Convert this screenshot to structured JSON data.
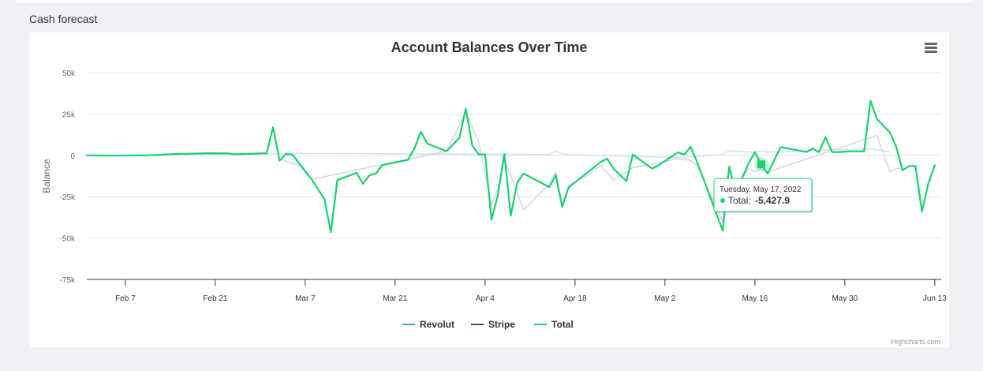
{
  "page": {
    "section_title": "Cash forecast"
  },
  "chart_menu": {
    "icon": "hamburger-menu-icon"
  },
  "credits": "Highcharts.com",
  "tooltip": {
    "date": "Tuesday, May 17, 2022",
    "series_label": "Total:",
    "value": "-5,427.9"
  },
  "colors": {
    "revolut": "#4a9fe0",
    "stripe": "#434891",
    "total": "#1bd06e",
    "grid": "#e6e6e6"
  },
  "chart_data": {
    "type": "line",
    "title": "Account Balances Over Time",
    "xlabel": "",
    "ylabel": "Balance",
    "ylim": [
      -75000,
      50000
    ],
    "yticks": [
      50000,
      25000,
      0,
      -25000,
      -50000,
      -75000
    ],
    "ytick_labels": [
      "50k",
      "25k",
      "0",
      "-25k",
      "-50k",
      "-75k"
    ],
    "xticks": [
      "2022-02-07",
      "2022-02-21",
      "2022-03-07",
      "2022-03-21",
      "2022-04-04",
      "2022-04-18",
      "2022-05-02",
      "2022-05-16",
      "2022-05-30",
      "2022-06-13"
    ],
    "xtick_labels": [
      "Feb 7",
      "Feb 21",
      "Mar 7",
      "Mar 21",
      "Apr 4",
      "Apr 18",
      "May 2",
      "May 16",
      "May 30",
      "Jun 13"
    ],
    "xlim": [
      "2022-02-01",
      "2022-06-14"
    ],
    "legend": [
      "Revolut",
      "Stripe",
      "Total"
    ],
    "legend_position": "bottom-center",
    "grid": true,
    "series": [
      {
        "name": "Total",
        "x": [
          "2022-02-01",
          "2022-02-05",
          "2022-02-10",
          "2022-02-15",
          "2022-02-20",
          "2022-02-23",
          "2022-02-24",
          "2022-03-01",
          "2022-03-02",
          "2022-03-03",
          "2022-03-04",
          "2022-03-05",
          "2022-03-08",
          "2022-03-10",
          "2022-03-11",
          "2022-03-12",
          "2022-03-15",
          "2022-03-16",
          "2022-03-17",
          "2022-03-18",
          "2022-03-19",
          "2022-03-23",
          "2022-03-24",
          "2022-03-25",
          "2022-03-26",
          "2022-03-29",
          "2022-03-31",
          "2022-04-01",
          "2022-04-02",
          "2022-04-03",
          "2022-04-04",
          "2022-04-05",
          "2022-04-06",
          "2022-04-07",
          "2022-04-08",
          "2022-04-09",
          "2022-04-10",
          "2022-04-14",
          "2022-04-15",
          "2022-04-16",
          "2022-04-17",
          "2022-04-22",
          "2022-04-23",
          "2022-04-24",
          "2022-04-26",
          "2022-04-27",
          "2022-04-30",
          "2022-05-01",
          "2022-05-04",
          "2022-05-05",
          "2022-05-06",
          "2022-05-07",
          "2022-05-11",
          "2022-05-12",
          "2022-05-13",
          "2022-05-15",
          "2022-05-16",
          "2022-05-17",
          "2022-05-18",
          "2022-05-20",
          "2022-05-24",
          "2022-05-25",
          "2022-05-26",
          "2022-05-27",
          "2022-05-28",
          "2022-05-29",
          "2022-05-31",
          "2022-06-02",
          "2022-06-03",
          "2022-06-04",
          "2022-06-06",
          "2022-06-07",
          "2022-06-08",
          "2022-06-09",
          "2022-06-10",
          "2022-06-11",
          "2022-06-12",
          "2022-06-13"
        ],
        "values": [
          0,
          -200,
          0,
          800,
          1300,
          1200,
          600,
          1300,
          17000,
          -3200,
          800,
          500,
          -14500,
          -26500,
          -46500,
          -15000,
          -10500,
          -17200,
          -12000,
          -11000,
          -5900,
          -2700,
          4200,
          14300,
          7100,
          2500,
          10600,
          28200,
          6000,
          500,
          600,
          -39000,
          -24000,
          800,
          -36500,
          -16500,
          -11000,
          -19200,
          -12000,
          -31000,
          -19500,
          -4000,
          -2000,
          -8000,
          -15600,
          500,
          -8000,
          -6000,
          1800,
          400,
          5200,
          -4000,
          -45500,
          -6700,
          -22500,
          -5000,
          2000,
          -5428,
          -11000,
          5000,
          2000,
          4000,
          2000,
          11000,
          2000,
          2000,
          2500,
          2500,
          33000,
          22000,
          14000,
          5000,
          -9000,
          -6500,
          -6500,
          -34000,
          -17000,
          -6000
        ]
      },
      {
        "name": "Revolut",
        "x": [
          "2022-02-01",
          "2022-03-01",
          "2022-03-04",
          "2022-04-14",
          "2022-04-15",
          "2022-04-16",
          "2022-04-17",
          "2022-05-04",
          "2022-05-11",
          "2022-05-12",
          "2022-05-15",
          "2022-05-16",
          "2022-05-17",
          "2022-05-18",
          "2022-06-03",
          "2022-06-06"
        ],
        "values": [
          0,
          800,
          1300,
          500,
          2500,
          800,
          500,
          -1500,
          500,
          2800,
          2000,
          2000,
          2500,
          2000,
          4000,
          2000
        ]
      },
      {
        "name": "Stripe",
        "x": [
          "2022-03-03",
          "2022-03-05",
          "2022-03-06",
          "2022-03-08",
          "2022-03-29",
          "2022-04-01",
          "2022-04-03",
          "2022-04-05",
          "2022-04-06",
          "2022-04-07",
          "2022-04-10",
          "2022-04-14",
          "2022-04-15",
          "2022-04-16",
          "2022-04-17",
          "2022-04-20",
          "2022-04-22",
          "2022-04-24",
          "2022-04-27",
          "2022-05-04",
          "2022-05-06",
          "2022-05-07",
          "2022-05-11",
          "2022-05-12",
          "2022-05-13",
          "2022-05-15",
          "2022-05-16",
          "2022-05-17",
          "2022-05-18",
          "2022-06-04",
          "2022-06-06",
          "2022-06-07",
          "2022-06-08"
        ],
        "values": [
          -2000,
          -5000,
          -6000,
          -14500,
          2500,
          26000,
          8000,
          -30000,
          -20000,
          -2000,
          -33000,
          -17000,
          -10000,
          -30000,
          -18000,
          -12000,
          -6000,
          -15000,
          -7500,
          -2000,
          -3000,
          -6000,
          -40000,
          -8000,
          -20000,
          -8000,
          -10000,
          -8000,
          -10000,
          12000,
          -10000,
          -8000,
          -8000
        ]
      }
    ]
  }
}
